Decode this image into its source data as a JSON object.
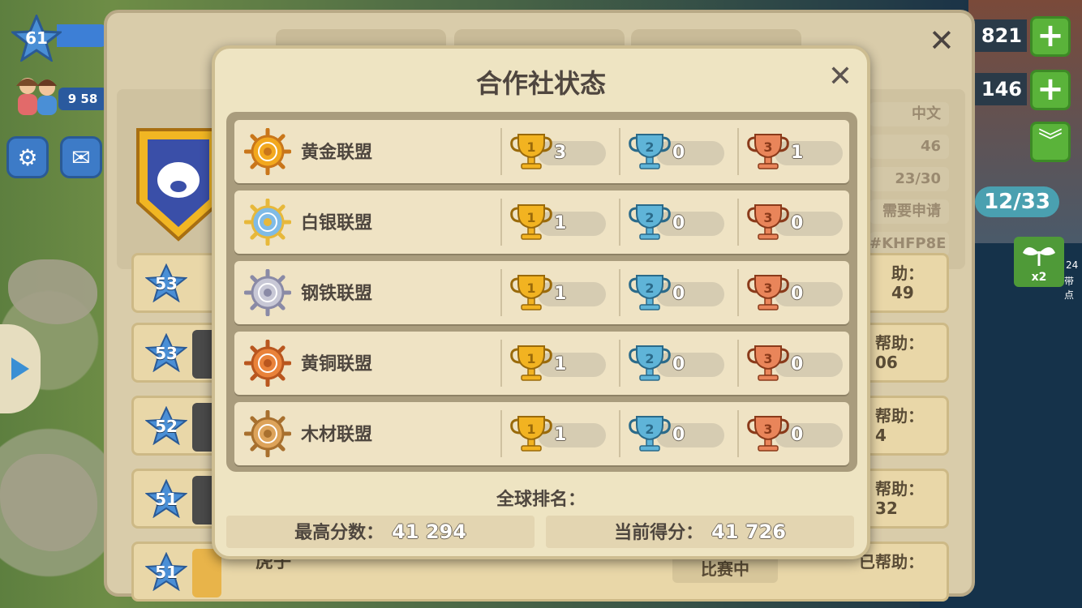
{
  "hud": {
    "player_level": "61",
    "population": "9 58",
    "resource_top": "821",
    "resource_mid": "146",
    "helpers_count": "12/33",
    "plant_multiplier": "x2",
    "plant_timer": "24",
    "plant_caption": "带点"
  },
  "coop_panel": {
    "info": [
      "中文",
      "46",
      "23/30",
      "需要申请",
      "#KHFP8E"
    ],
    "members": [
      {
        "level": "53",
        "helped": "助：",
        "helped_value": "49"
      },
      {
        "level": "53",
        "helped": "帮助：",
        "helped_value": "06"
      },
      {
        "level": "52",
        "helped": "帮助：",
        "helped_value": "4"
      },
      {
        "level": "51",
        "helped": "帮助：",
        "helped_value": "32"
      },
      {
        "level": "51",
        "name": "虎子",
        "status": "比赛中",
        "helped": "已帮助：",
        "helped_value": ""
      }
    ]
  },
  "modal": {
    "title": "合作社状态",
    "tiers": [
      {
        "name": "黄金联盟",
        "badge": "gold-wheel-icon",
        "gold": "3",
        "silver": "0",
        "bronze": "1"
      },
      {
        "name": "白银联盟",
        "badge": "silver-wheel-icon",
        "gold": "1",
        "silver": "0",
        "bronze": "0"
      },
      {
        "name": "钢铁联盟",
        "badge": "steel-wheel-icon",
        "gold": "1",
        "silver": "0",
        "bronze": "0"
      },
      {
        "name": "黄铜联盟",
        "badge": "brass-wheel-icon",
        "gold": "1",
        "silver": "0",
        "bronze": "0"
      },
      {
        "name": "木材联盟",
        "badge": "wood-wheel-icon",
        "gold": "1",
        "silver": "0",
        "bronze": "0"
      }
    ],
    "global_rank_label": "全球排名：",
    "best_score_label": "最高分数：",
    "best_score": "41 294",
    "current_score_label": "当前得分：",
    "current_score": "41 726"
  },
  "colors": {
    "modal_bg": "#eee4c2",
    "gold_trophy": "#f2b321",
    "silver_trophy": "#5fb4d8",
    "bronze_trophy": "#e9855a"
  }
}
